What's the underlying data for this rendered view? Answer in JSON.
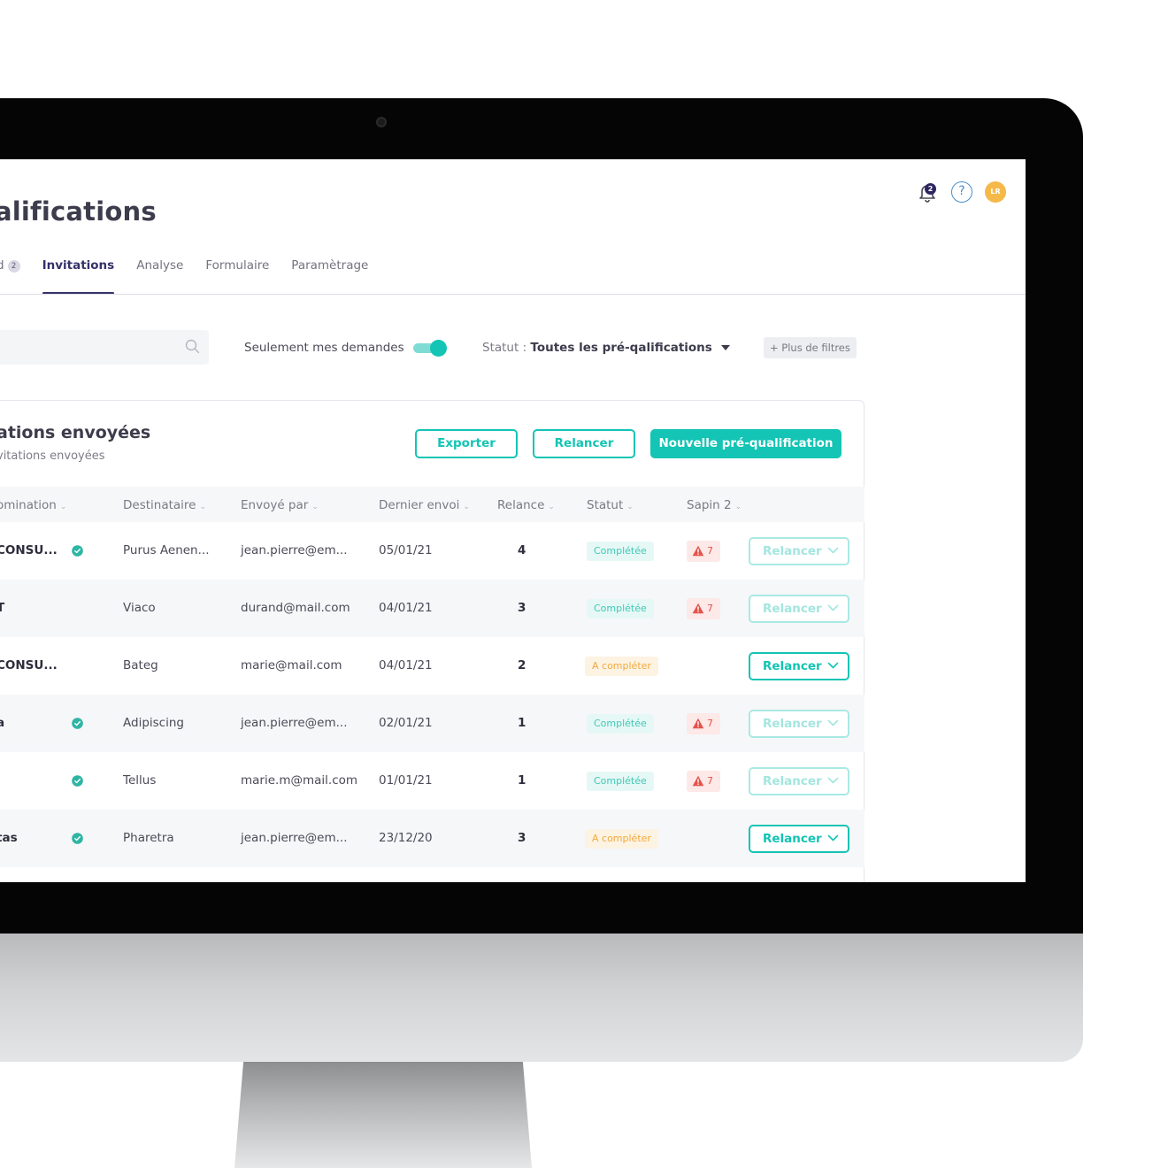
{
  "header": {
    "title": "alifications",
    "notification_count": "2",
    "help_glyph": "?",
    "avatar_initials": "LR"
  },
  "tabs": [
    {
      "label": "d",
      "count": "2",
      "active": false
    },
    {
      "label": "Invitations",
      "active": true
    },
    {
      "label": "Analyse",
      "active": false
    },
    {
      "label": "Formulaire",
      "active": false
    },
    {
      "label": "Paramètrage",
      "active": false
    }
  ],
  "filters": {
    "search_placeholder": "",
    "only_mine_label": "Seulement mes demandes",
    "only_mine_enabled": true,
    "status_prefix": "Statut : ",
    "status_value": "Toutes les pré-qalifications",
    "more_filters_label": "+ Plus de filtres"
  },
  "card": {
    "title": "ations envoyées",
    "subtitle": "vitations envoyées",
    "export_label": "Exporter",
    "relaunch_label": "Relancer",
    "new_label": "Nouvelle pré-qualification"
  },
  "columns": [
    "omination",
    "Destinataire",
    "Envoyé par",
    "Dernier envoi",
    "Relance",
    "Statut",
    "Sapin 2"
  ],
  "rows": [
    {
      "name": "CONSU...",
      "verified": true,
      "recipient": "Purus Aenen...",
      "sender": "jean.pierre@em...",
      "date": "05/01/21",
      "relance": "4",
      "status": "Complétée",
      "alert": "7",
      "action": "Relancer",
      "faded": true
    },
    {
      "name": "T",
      "verified": false,
      "recipient": "Viaco",
      "sender": "durand@mail.com",
      "date": "04/01/21",
      "relance": "3",
      "status": "Complétée",
      "alert": "7",
      "action": "Relancer",
      "faded": true
    },
    {
      "name": "CONSU...",
      "verified": false,
      "recipient": "Bateg",
      "sender": "marie@mail.com",
      "date": "04/01/21",
      "relance": "2",
      "status": "A compléter",
      "alert": "",
      "action": "Relancer",
      "faded": false
    },
    {
      "name": "a",
      "verified": true,
      "recipient": "Adipiscing",
      "sender": "jean.pierre@em...",
      "date": "02/01/21",
      "relance": "1",
      "status": "Complétée",
      "alert": "7",
      "action": "Relancer",
      "faded": true
    },
    {
      "name": "",
      "verified": true,
      "recipient": "Tellus",
      "sender": "marie.m@mail.com",
      "date": "01/01/21",
      "relance": "1",
      "status": "Complétée",
      "alert": "7",
      "action": "Relancer",
      "faded": true
    },
    {
      "name": "tas",
      "verified": true,
      "recipient": "Pharetra",
      "sender": "jean.pierre@em...",
      "date": "23/12/20",
      "relance": "3",
      "status": "A compléter",
      "alert": "",
      "action": "Relancer",
      "faded": false
    }
  ],
  "colors": {
    "accent": "#14c4b4",
    "brand_dark": "#35316a",
    "warning": "#f0a93c",
    "danger": "#e4534b"
  },
  "icons": {
    "notifications": "bell-icon",
    "help": "help-circle-icon",
    "search": "search-icon",
    "verified": "verified-badge-icon",
    "alert": "warning-triangle-icon",
    "dropdown": "chevron-down-icon"
  }
}
